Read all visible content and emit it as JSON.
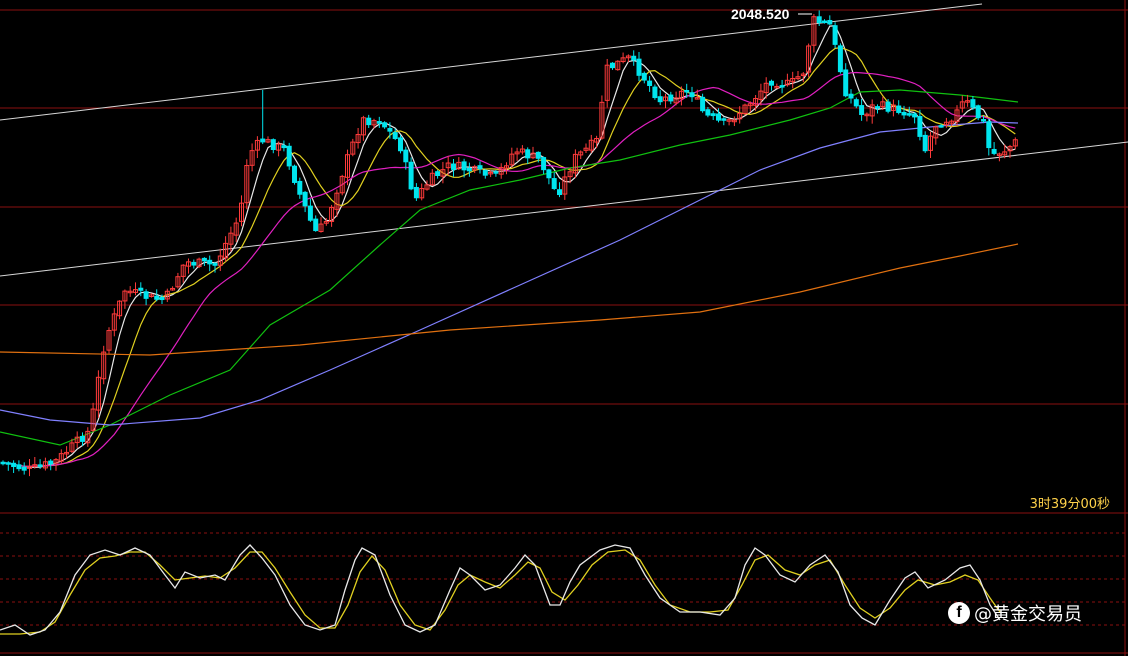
{
  "chart_data": {
    "type": "candlestick",
    "high_label": "2048.520",
    "countdown": "3时39分00秒",
    "watermark": "@黄金交易员",
    "ma_colors": {
      "ma5": "#e8e8e8",
      "ma10": "#e0d020",
      "ma20": "#e020c0",
      "ma60": "#10c010",
      "ma120": "#8080ff",
      "ma250": "#e07010"
    },
    "colors": {
      "up": "#ff3b3b",
      "down": "#00e5ee",
      "grid": "#8a0f0f",
      "channel": "#d8d8d8",
      "stoch_k": "#e8e8e8",
      "stoch_d": "#e0d020"
    },
    "price_range": [
      1950,
      2052
    ]
  }
}
